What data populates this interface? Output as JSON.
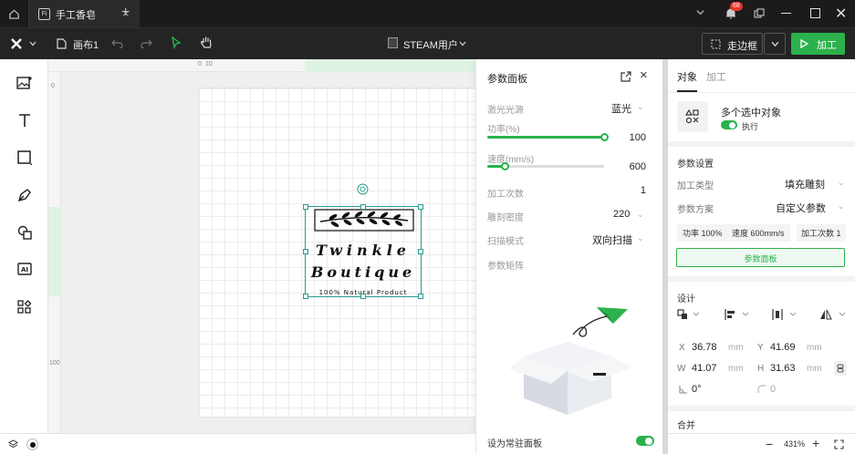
{
  "titlebar": {
    "tab_icon_text": "Fi",
    "tab_title": "手工香皂",
    "notification_count": "68"
  },
  "toolbar": {
    "canvas_name": "画布1",
    "device_name": "STEAM用户",
    "frame_button": "走边框",
    "process_button": "加工"
  },
  "rulers": {
    "top_ticks": [
      "0",
      "10"
    ],
    "left_ticks": [
      "0",
      "100"
    ]
  },
  "artwork": {
    "line1": "Twinkle",
    "line2": "Boutique",
    "line3": "100% Natural Product"
  },
  "param_panel": {
    "title": "参数面板",
    "laser_label": "激光光源",
    "laser_value": "蓝光",
    "power_label": "功率(%)",
    "power_value": "100",
    "power_fraction": 1.0,
    "speed_label": "速度(mm/s)",
    "speed_value": "600",
    "speed_fraction": 0.15,
    "passes_label": "加工次数",
    "passes_value": "1",
    "density_label": "雕刻密度",
    "density_value": "220",
    "scan_label": "扫描模式",
    "scan_value": "双向扫描",
    "matrix_label": "参数矩阵",
    "pin_label": "设为常驻面板"
  },
  "right_panel": {
    "tab_object": "对象",
    "tab_process": "加工",
    "multi_select": "多个选中对象",
    "execute": "执行",
    "param_settings": "参数设置",
    "process_type_label": "加工类型",
    "process_type_value": "填充雕刻",
    "param_scheme_label": "参数方案",
    "param_scheme_value": "自定义参数",
    "chip_power": "功率 100%",
    "chip_speed": "速度 600mm/s",
    "chip_passes": "加工次数 1",
    "param_panel_button": "参数面板",
    "design": "设计",
    "x_label": "X",
    "x_value": "36.78",
    "y_label": "Y",
    "y_value": "41.69",
    "w_label": "W",
    "w_value": "41.07",
    "h_label": "H",
    "h_value": "31.63",
    "unit": "mm",
    "rotation": "0°",
    "corner": "0",
    "merge": "合并",
    "zoom": "431%"
  },
  "colors": {
    "accent": "#2bb24c",
    "titlebar": "#1b1b1b",
    "toolbar": "#242424",
    "badge": "#e5352b"
  }
}
